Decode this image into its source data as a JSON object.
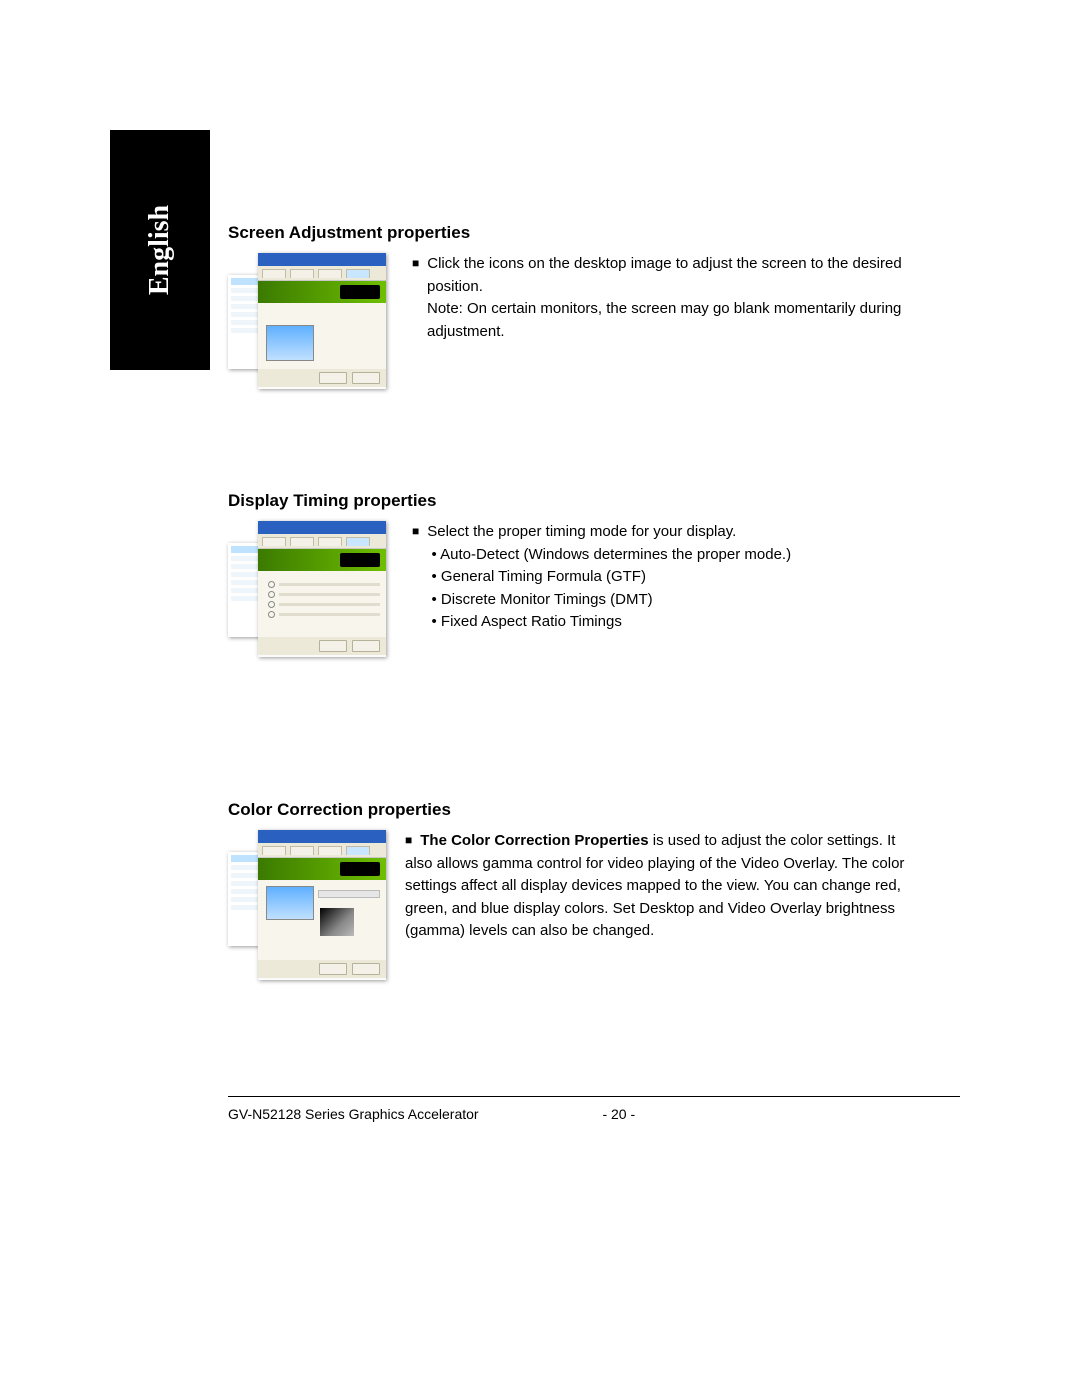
{
  "language_tab": "English",
  "sections": {
    "screen_adjust": {
      "heading": "Screen Adjustment properties",
      "bullet1": "Click the icons on the desktop image to adjust the screen to the desired position.",
      "note": "Note: On certain monitors, the screen may go blank momentarily during adjustment."
    },
    "display_timing": {
      "heading": "Display Timing properties",
      "bullet1": "Select the proper timing mode for your display.",
      "sub1": "• Auto-Detect (Windows determines the proper mode.)",
      "sub2": "• General Timing Formula (GTF)",
      "sub3": "• Discrete Monitor Timings (DMT)",
      "sub4": "• Fixed Aspect Ratio Timings"
    },
    "color_correction": {
      "heading": "Color Correction properties",
      "bold_lead": "The Color Correction Properties",
      "para_rest": " is used to adjust the color settings. It also allows gamma control for video playing of the Video Overlay. The color settings affect all display devices mapped to the view. You can change red, green, and blue display colors. Set Desktop and Video Overlay brightness (gamma) levels can also be changed."
    }
  },
  "footer": {
    "product": "GV-N52128 Series Graphics Accelerator",
    "page": "- 20 -"
  }
}
